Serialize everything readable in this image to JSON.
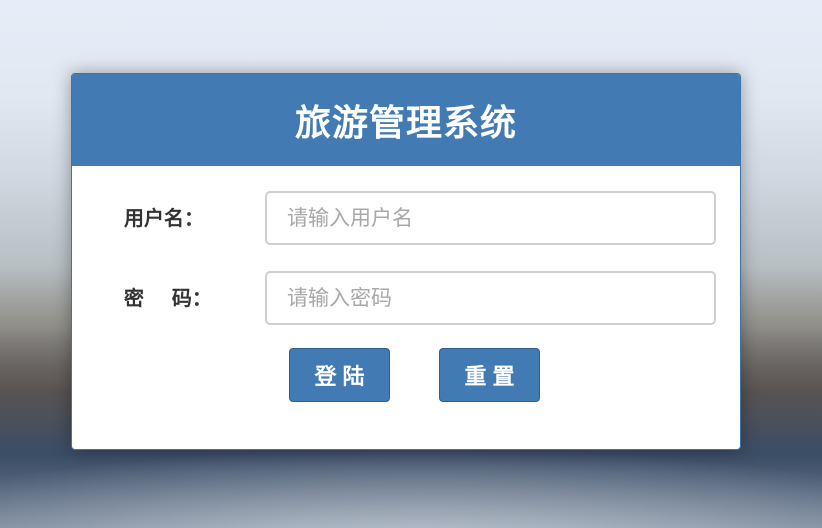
{
  "app": {
    "title": "旅游管理系统"
  },
  "form": {
    "username": {
      "label": "用户名：",
      "value": "",
      "placeholder": "请输入用户名"
    },
    "password": {
      "label": "密    码：",
      "value": "",
      "placeholder": "请输入密码"
    }
  },
  "buttons": {
    "login_label": "登陆",
    "reset_label": "重置"
  },
  "colors": {
    "accent": "#427bb3",
    "panel_bg": "#ffffff",
    "label_text": "#333333",
    "placeholder_text": "#a8a8a8"
  }
}
